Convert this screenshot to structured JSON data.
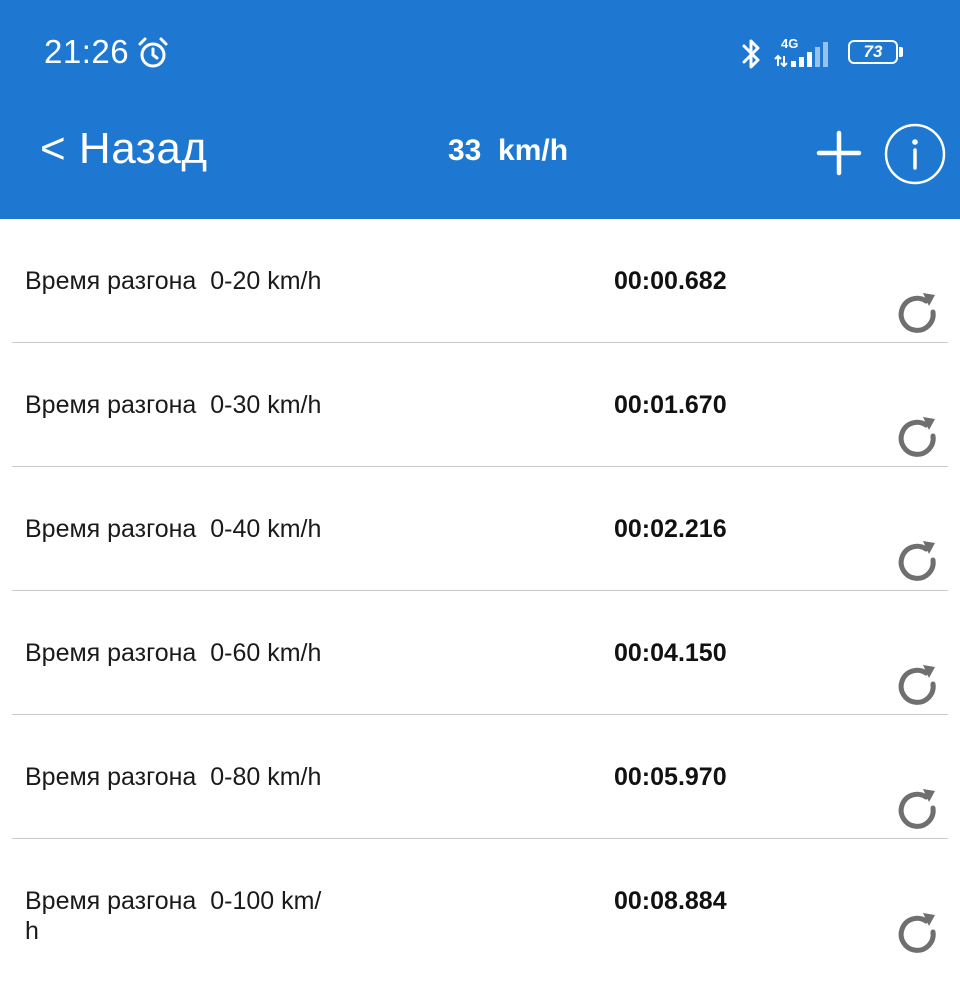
{
  "status_bar": {
    "time": "21:26",
    "alarm_icon": "alarm-clock-icon",
    "bluetooth_icon": "bluetooth-icon",
    "network_type": "4G",
    "signal_icon": "cellular-signal-icon",
    "battery_level": "73"
  },
  "header": {
    "back_label": "< Назад",
    "title": "33  km/h",
    "add_icon": "plus-icon",
    "info_icon": "info-icon",
    "background_color": "#1e78d2"
  },
  "results": [
    {
      "label": "Время разгона  0-20 km/h",
      "time": "00:00.682"
    },
    {
      "label": "Время разгона  0-30 km/h",
      "time": "00:01.670"
    },
    {
      "label": "Время разгона  0-40 km/h",
      "time": "00:02.216"
    },
    {
      "label": "Время разгона  0-60 km/h",
      "time": "00:04.150"
    },
    {
      "label": "Время разгона  0-80 km/h",
      "time": "00:05.970"
    },
    {
      "label": "Время разгона  0-100 km/\nh",
      "time": "00:08.884"
    }
  ],
  "row_icon": "refresh-icon"
}
